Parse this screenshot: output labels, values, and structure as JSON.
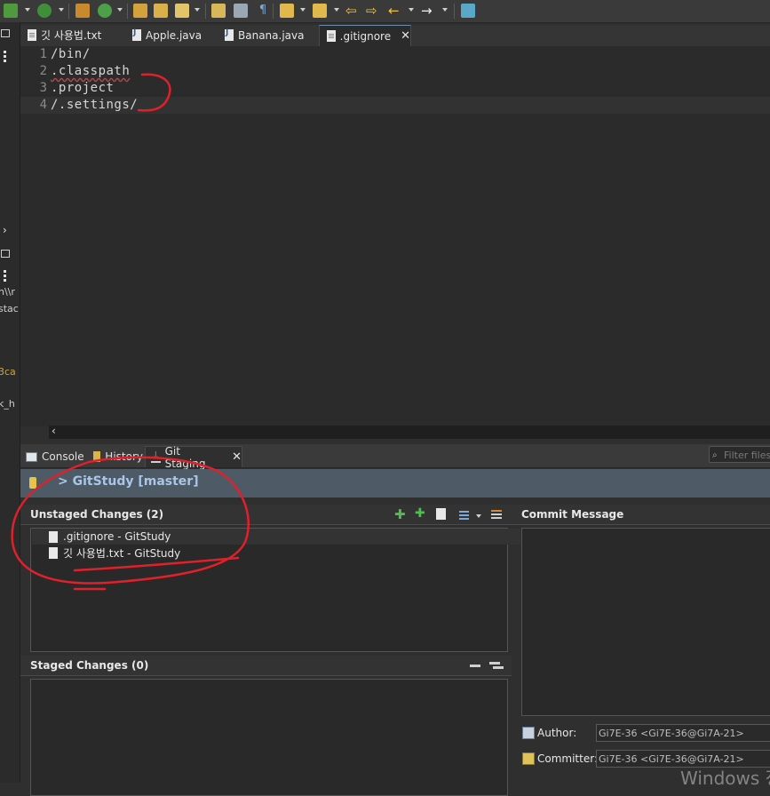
{
  "colors": {
    "accent": "#a9c6e6",
    "annotation": "#e0202a",
    "editor_bg": "#2b2b2b"
  },
  "toolbar": {
    "icons": [
      "debug-icon",
      "run-icon",
      "new-package-icon",
      "new-class-icon",
      "open-type-icon",
      "open-task-icon",
      "highlight-icon",
      "toggle-mark-icon",
      "block-select-icon",
      "whitespace-icon",
      "next-annotation-icon",
      "prev-annotation-icon",
      "last-edit-icon",
      "back-icon",
      "forward-icon",
      "external-tools-icon"
    ]
  },
  "left_strip": {
    "fragments": [
      "n\\\\r",
      "stac",
      "3ca",
      "k_h"
    ]
  },
  "editor_tabs": [
    {
      "label": "깃 사용법.txt",
      "icon": "text-file-icon"
    },
    {
      "label": "Apple.java",
      "icon": "java-file-icon"
    },
    {
      "label": "Banana.java",
      "icon": "java-file-icon"
    },
    {
      "label": ".gitignore",
      "icon": "text-file-icon",
      "active": true
    }
  ],
  "editor": {
    "lines": [
      {
        "num": "1",
        "text": "/bin/"
      },
      {
        "num": "2",
        "text": ".classpath"
      },
      {
        "num": "3",
        "text": ".project"
      },
      {
        "num": "4",
        "text": "/.settings/"
      }
    ]
  },
  "view_tabs": [
    {
      "label": "Console",
      "icon": "console-icon"
    },
    {
      "label": "History",
      "icon": "history-icon"
    },
    {
      "label": "Git Staging",
      "icon": "git-staging-icon",
      "active": true
    }
  ],
  "filter_placeholder": "Filter files",
  "repo": {
    "title": "> GitStudy [master]"
  },
  "unstaged": {
    "title": "Unstaged Changes (2)",
    "items": [
      ".gitignore - GitStudy",
      "깃 사용법.txt - GitStudy"
    ]
  },
  "staged": {
    "title": "Staged Changes (0)"
  },
  "commit": {
    "title": "Commit Message",
    "author_label": "Author:",
    "author_value": "Gi7E-36 <Gi7E-36@Gi7A-21>",
    "committer_label": "Committer:",
    "committer_value": "Gi7E-36 <Gi7E-36@Gi7A-21>"
  },
  "watermark": "Windows 정"
}
